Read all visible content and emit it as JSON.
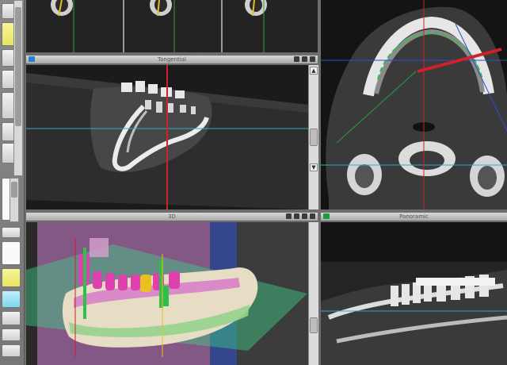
{
  "panels": {
    "sagittal": {
      "title": "Tangential"
    },
    "render3d": {
      "title": "3D"
    },
    "panoramic": {
      "title": "Panoramic"
    }
  },
  "colors": {
    "window_bg": "#6d6d6d",
    "header_bg": "#c8c8c8",
    "panel_bg": "#111111",
    "crosshair_red": "#d0202a",
    "guide_cyan": "#3aa7c9",
    "guide_green": "#28a040",
    "guide_blue": "#2d4fd0",
    "active_indicator": "#2a7fd4",
    "pano_indicator": "#1f9a3a",
    "plane_magenta": "#c070c0",
    "plane_green": "#3fcf88",
    "teeth_magenta": "#e03fb0",
    "implant_green": "#2fbf4a"
  },
  "icons": [
    "orientation-icon",
    "dropdown-icon",
    "settings-icon",
    "close-icon",
    "eye-icon",
    "scroll-up-icon",
    "scroll-down-icon"
  ]
}
